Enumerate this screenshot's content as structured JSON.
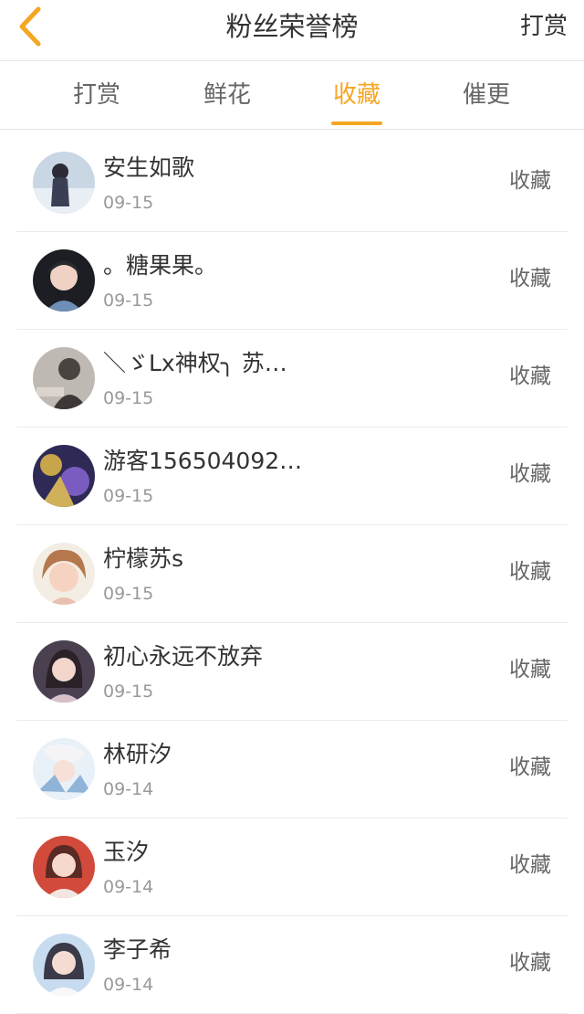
{
  "header": {
    "title": "粉丝荣誉榜",
    "right_action": "打赏",
    "back_icon": "chevron-left-icon",
    "accent_color": "#f5a623"
  },
  "tabs": [
    {
      "label": "打赏",
      "active": false
    },
    {
      "label": "鲜花",
      "active": false
    },
    {
      "label": "收藏",
      "active": true
    },
    {
      "label": "催更",
      "active": false
    }
  ],
  "fans": [
    {
      "name": "安生如歌",
      "date": "09-15",
      "action": "收藏"
    },
    {
      "name": "。糖果果。",
      "date": "09-15",
      "action": "收藏"
    },
    {
      "name": "＼ゞLx神权╮ 苏…",
      "date": "09-15",
      "action": "收藏"
    },
    {
      "name": "游客156504092…",
      "date": "09-15",
      "action": "收藏"
    },
    {
      "name": "柠檬苏s",
      "date": "09-15",
      "action": "收藏"
    },
    {
      "name": "初心永远不放弃",
      "date": "09-15",
      "action": "收藏"
    },
    {
      "name": "林研汐",
      "date": "09-14",
      "action": "收藏"
    },
    {
      "name": "玉汐",
      "date": "09-14",
      "action": "收藏"
    },
    {
      "name": "李子希",
      "date": "09-14",
      "action": "收藏"
    }
  ]
}
